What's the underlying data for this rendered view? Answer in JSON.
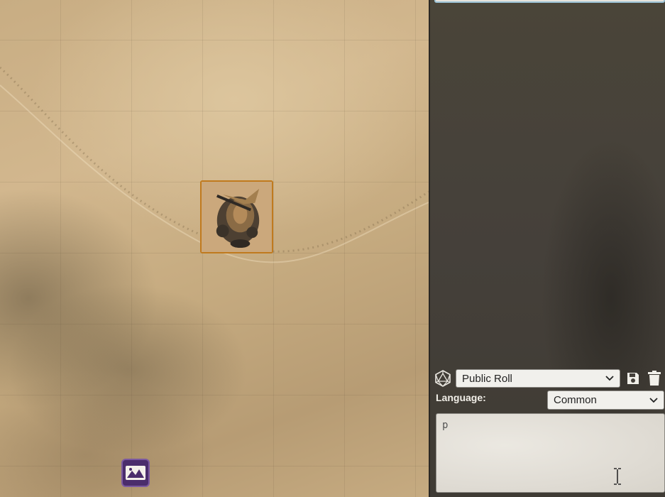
{
  "roll_mode": {
    "selected": "Public Roll"
  },
  "language": {
    "label": "Language:",
    "selected": "Common"
  },
  "chat_input": {
    "value": "p"
  },
  "colors": {
    "token_border": "#c07a1e",
    "map_tool_bg": "#4b2d6c",
    "sidebar_bg": "#45403a",
    "input_focus": "#9cc3d6"
  },
  "icons": {
    "roll_mode": "d20-icon",
    "save": "save-icon",
    "clear": "trash-icon",
    "map_tool": "map-tool-icon",
    "cursor": "i-beam-cursor"
  }
}
